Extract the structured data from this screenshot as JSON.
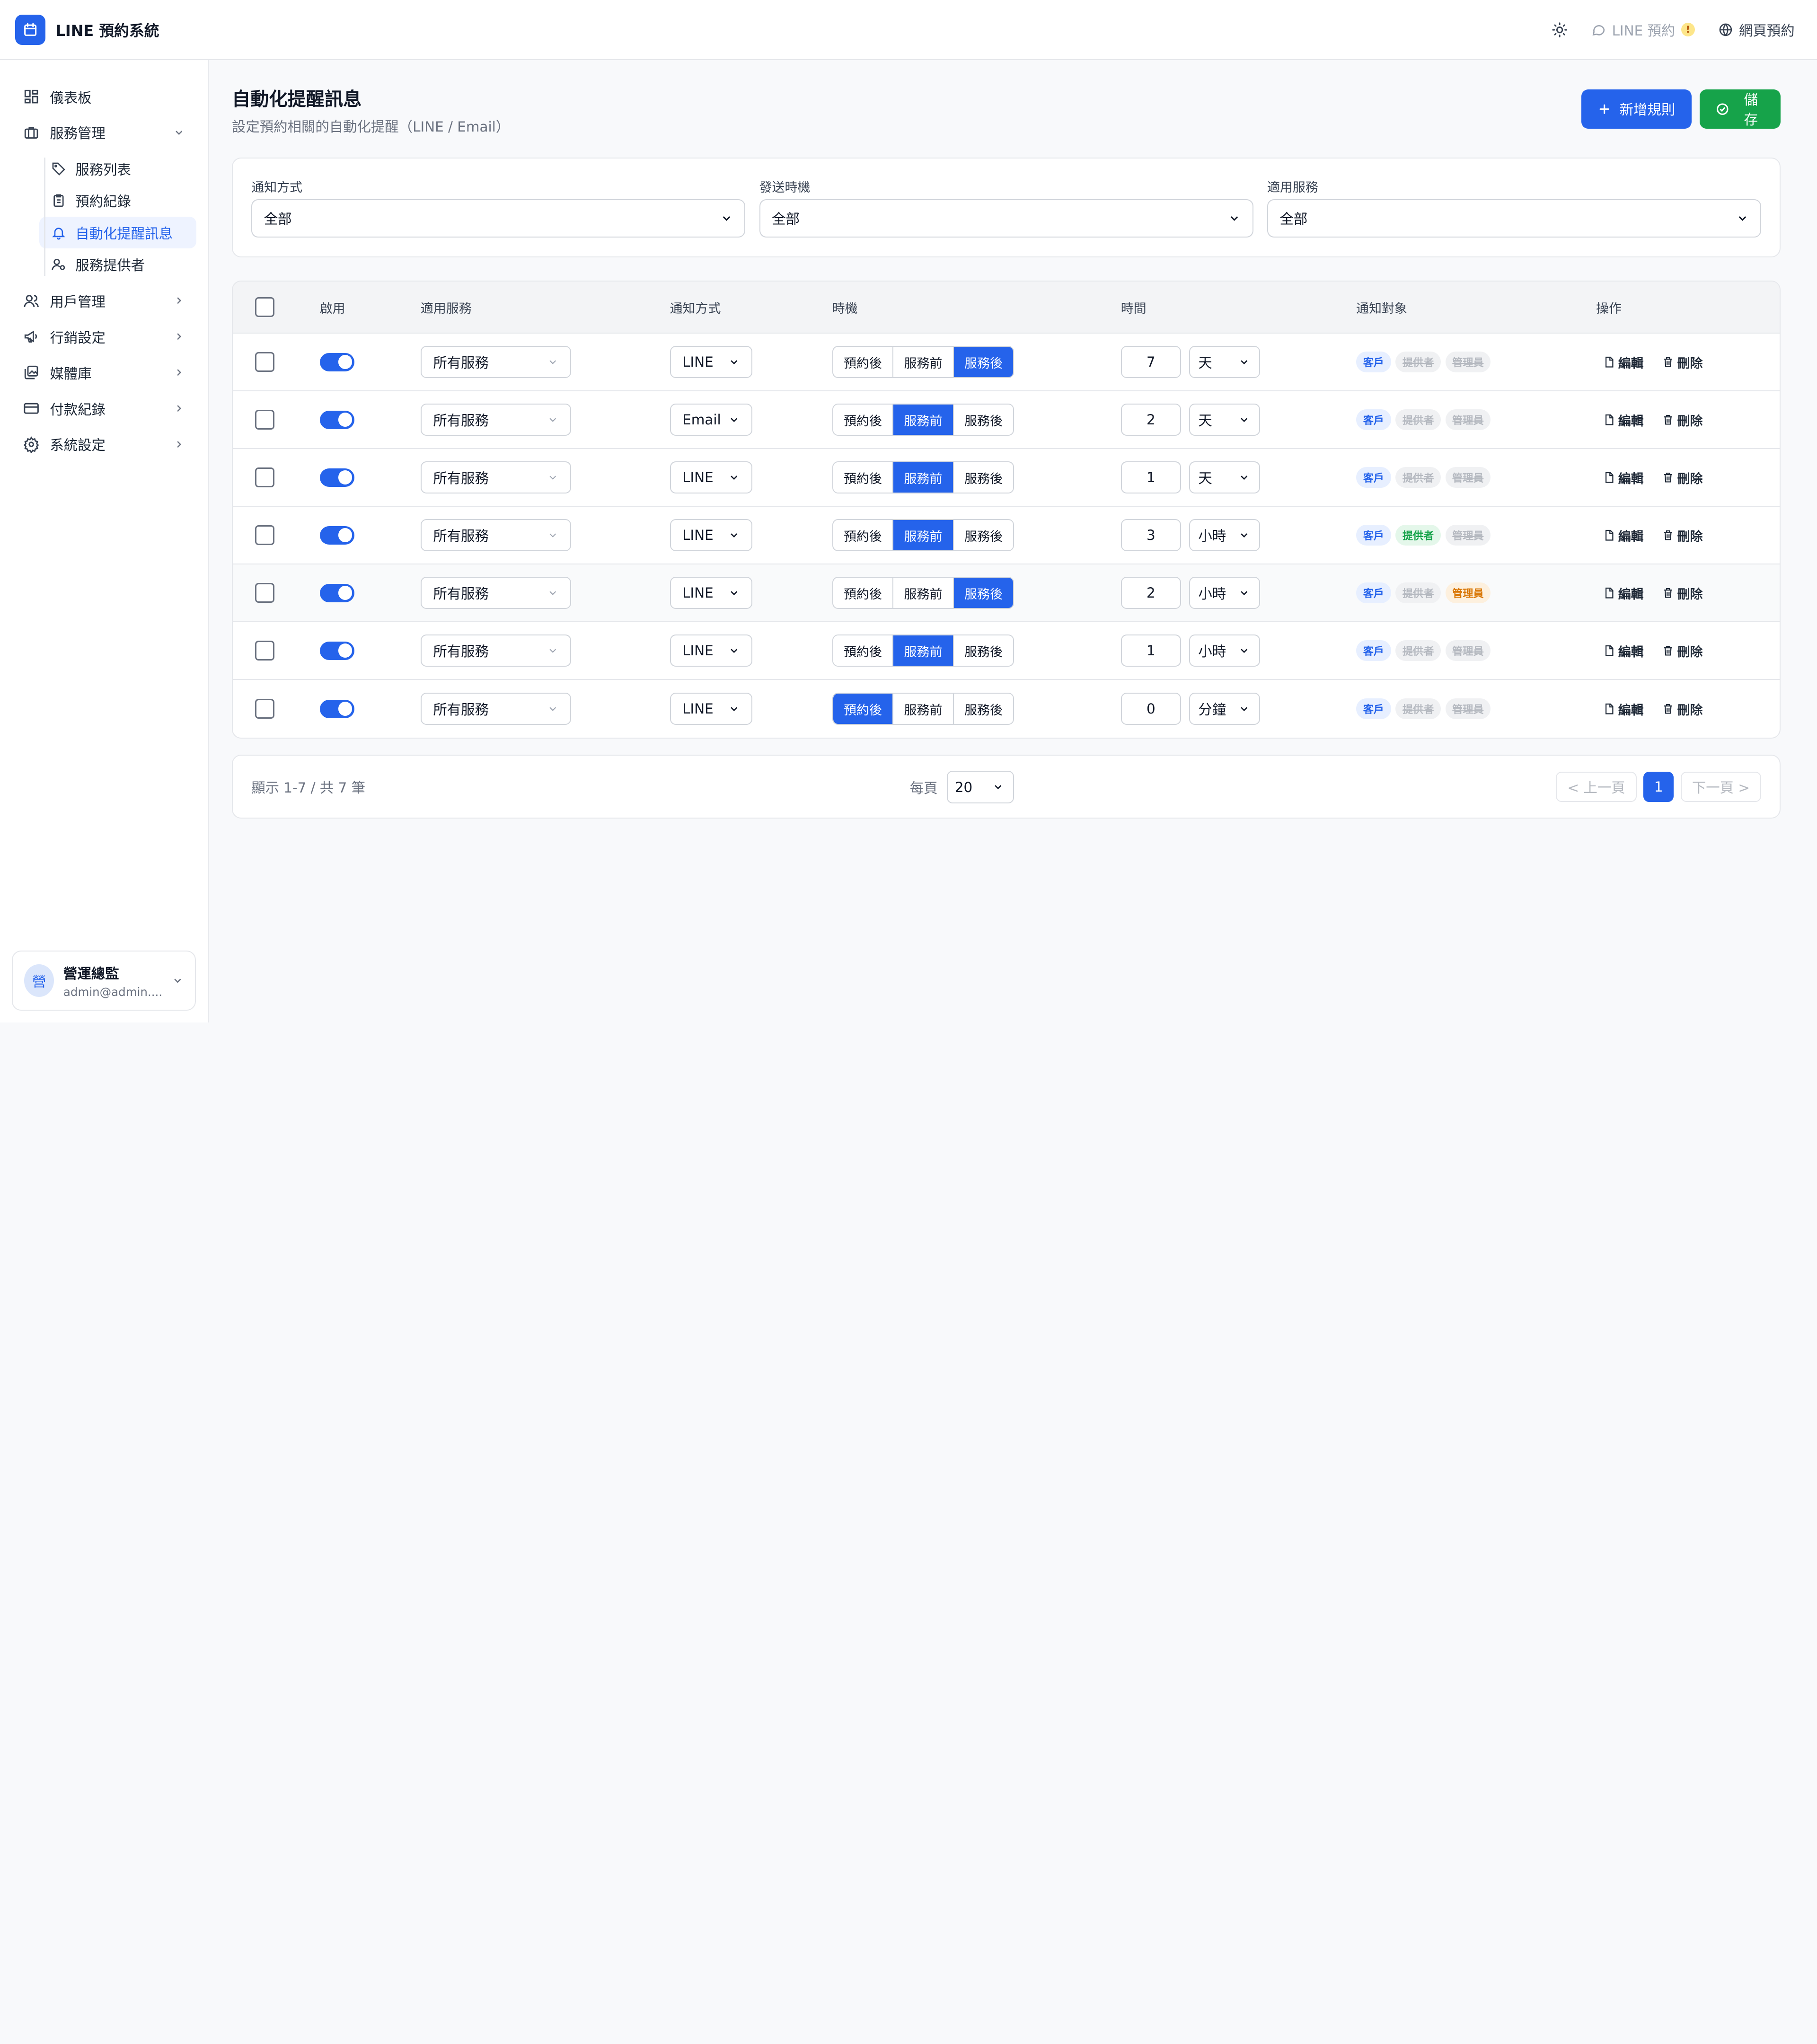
{
  "app": {
    "title": "LINE 預約系統"
  },
  "topbar": {
    "line_booking": "LINE 預約",
    "warning_mark": "!",
    "web_booking": "網頁預約"
  },
  "sidebar": {
    "dashboard": "儀表板",
    "service_mgmt": "服務管理",
    "service_list": "服務列表",
    "booking_records": "預約紀錄",
    "auto_reminders": "自動化提醒訊息",
    "providers": "服務提供者",
    "user_mgmt": "用戶管理",
    "marketing": "行銷設定",
    "media": "媒體庫",
    "payments": "付款紀錄",
    "system": "系統設定"
  },
  "user": {
    "avatar": "營",
    "name": "營運總監",
    "email": "admin@admin...."
  },
  "page": {
    "title": "自動化提醒訊息",
    "subtitle": "設定預約相關的自動化提醒（LINE / Email）"
  },
  "actions": {
    "add_rule": "新增規則",
    "save": "儲存"
  },
  "filters": {
    "method_label": "通知方式",
    "method_value": "全部",
    "timing_label": "發送時機",
    "timing_value": "全部",
    "service_label": "適用服務",
    "service_value": "全部"
  },
  "table": {
    "headers": {
      "enabled": "啟用",
      "service": "適用服務",
      "method": "通知方式",
      "timing": "時機",
      "time": "時間",
      "targets": "通知對象",
      "ops": "操作"
    },
    "timing_options": [
      "預約後",
      "服務前",
      "服務後"
    ],
    "target_labels": [
      "客戶",
      "提供者",
      "管理員"
    ],
    "edit": "編輯",
    "delete": "刪除",
    "rows": [
      {
        "enabled": true,
        "service": "所有服務",
        "method": "LINE",
        "timing": 2,
        "value": "7",
        "unit": "天",
        "targets": [
          true,
          false,
          false
        ]
      },
      {
        "enabled": true,
        "service": "所有服務",
        "method": "Email",
        "timing": 1,
        "value": "2",
        "unit": "天",
        "targets": [
          true,
          false,
          false
        ]
      },
      {
        "enabled": true,
        "service": "所有服務",
        "method": "LINE",
        "timing": 1,
        "value": "1",
        "unit": "天",
        "targets": [
          true,
          false,
          false
        ]
      },
      {
        "enabled": true,
        "service": "所有服務",
        "method": "LINE",
        "timing": 1,
        "value": "3",
        "unit": "小時",
        "targets": [
          true,
          true,
          false
        ]
      },
      {
        "enabled": true,
        "service": "所有服務",
        "method": "LINE",
        "timing": 2,
        "value": "2",
        "unit": "小時",
        "targets": [
          true,
          false,
          true
        ]
      },
      {
        "enabled": true,
        "service": "所有服務",
        "method": "LINE",
        "timing": 1,
        "value": "1",
        "unit": "小時",
        "targets": [
          true,
          false,
          false
        ]
      },
      {
        "enabled": true,
        "service": "所有服務",
        "method": "LINE",
        "timing": 0,
        "value": "0",
        "unit": "分鐘",
        "targets": [
          true,
          false,
          false
        ]
      }
    ]
  },
  "pager": {
    "info": "顯示 1-7 / 共 7 筆",
    "per_page_label": "每頁",
    "per_page": "20",
    "prev": "< 上一頁",
    "page": "1",
    "next": "下一頁 >"
  },
  "colors": {
    "primary": "#2563eb",
    "success": "#16a34a",
    "warning": "#d97706"
  }
}
